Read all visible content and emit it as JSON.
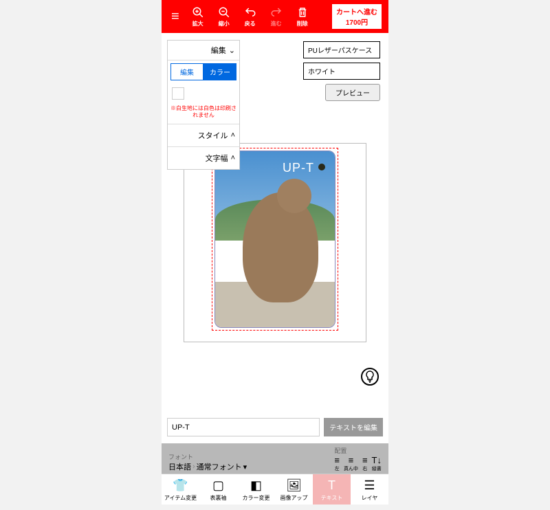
{
  "topbar": {
    "zoom_in": "拡大",
    "zoom_out": "縮小",
    "undo": "戻る",
    "redo": "進む",
    "delete": "削除",
    "cart": "カートへ進む",
    "price": "1700円"
  },
  "panel": {
    "edit": "編集",
    "tab_edit": "編集",
    "tab_color": "カラー",
    "warning": "※白生地には白色は印刷されません",
    "style": "スタイル",
    "char_width": "文字幅"
  },
  "info": {
    "product": "PUレザーパスケース",
    "color": "ホワイト",
    "preview": "プレビュー"
  },
  "canvas": {
    "overlay_text": "UP-T"
  },
  "textrow": {
    "value": "UP-T",
    "button": "テキストを編集"
  },
  "fa": {
    "font_label": "フォント",
    "lang": "日本語",
    "font": "通常フォント",
    "align_label": "配置",
    "left": "左",
    "center": "真ん中",
    "right": "右",
    "vert": "縦書"
  },
  "nav": {
    "item": "アイテム変更",
    "side": "表裏袖",
    "color": "カラー変更",
    "image": "画像アップ",
    "text": "テキスト",
    "layer": "レイヤ"
  }
}
